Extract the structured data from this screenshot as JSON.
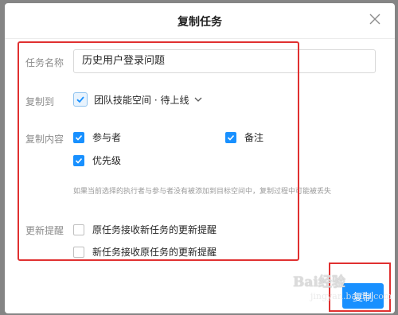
{
  "dialog": {
    "title": "复制任务"
  },
  "form": {
    "name_label": "任务名称",
    "name_value": "历史用户登录问题",
    "dest_label": "复制到",
    "dest_value": "团队技能空间 · 待上线",
    "content_label": "复制内容",
    "content_options": [
      {
        "label": "参与者",
        "checked": true
      },
      {
        "label": "备注",
        "checked": true
      },
      {
        "label": "优先级",
        "checked": true
      }
    ],
    "content_hint": "如果当前选择的执行者与参与者没有被添加到目标空间中，复制过程中可能被丢失",
    "reminder_label": "更新提醒",
    "reminder_options": [
      {
        "label": "原任务接收新任务的更新提醒",
        "checked": false
      },
      {
        "label": "新任务接收原任务的更新提醒",
        "checked": false
      }
    ]
  },
  "footer": {
    "confirm_label": "复制"
  },
  "watermark": {
    "text_main": "Bai经验",
    "text_sub": "jingyan.baidu.com"
  },
  "colors": {
    "accent": "#1890ff",
    "annotation": "#e03030",
    "overlay": "#858585"
  },
  "icons": [
    "close-icon",
    "space-icon",
    "chevron-down-icon",
    "check-icon"
  ]
}
